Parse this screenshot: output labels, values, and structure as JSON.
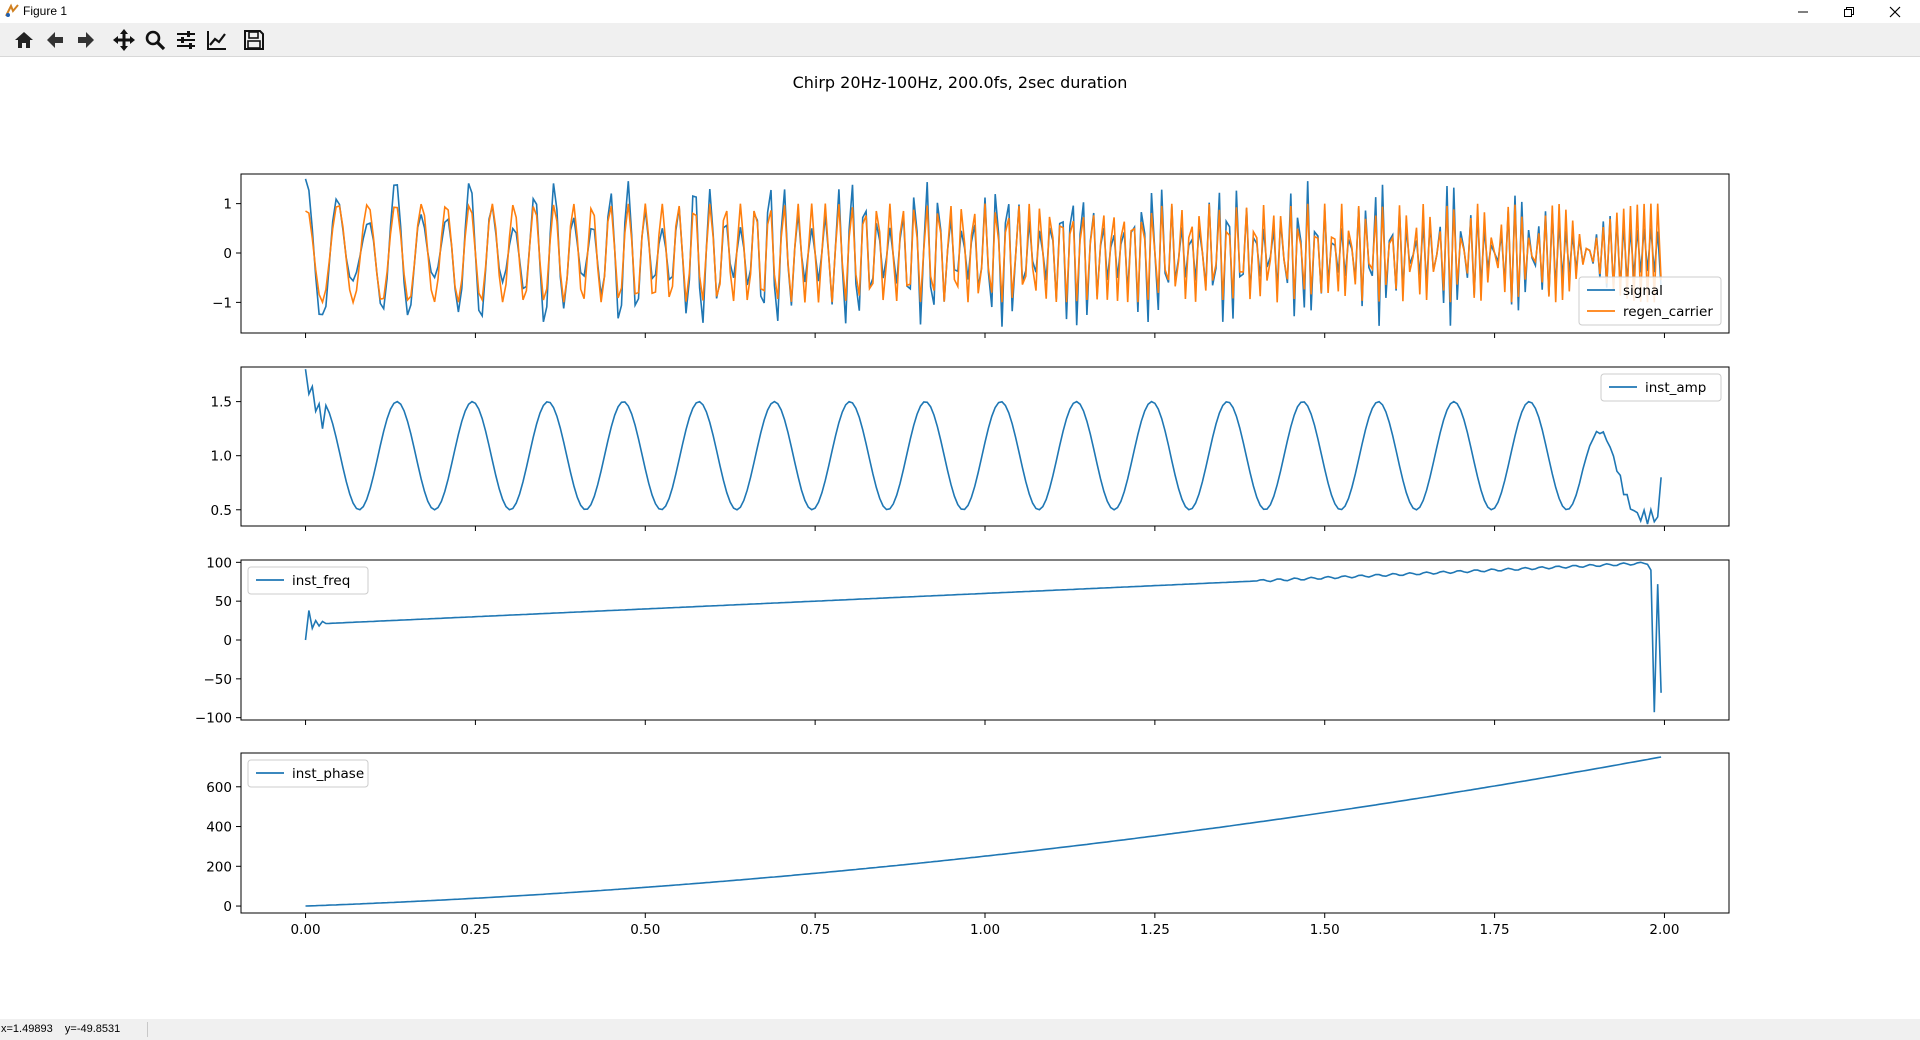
{
  "window": {
    "title": "Figure 1",
    "controls": [
      "minimize-icon",
      "restore-icon",
      "close-icon"
    ]
  },
  "toolbar": {
    "tools": [
      {
        "name": "home",
        "icon": "home-icon"
      },
      {
        "name": "back",
        "icon": "arrow-left-icon"
      },
      {
        "name": "forward",
        "icon": "arrow-right-icon"
      },
      {
        "name": "pan",
        "icon": "move-icon"
      },
      {
        "name": "zoom",
        "icon": "magnifier-icon"
      },
      {
        "name": "configure-subplots",
        "icon": "sliders-icon"
      },
      {
        "name": "edit-axes",
        "icon": "line-chart-icon"
      },
      {
        "name": "save",
        "icon": "floppy-disk-icon"
      }
    ]
  },
  "status": {
    "x_readout": "x=1.49893",
    "y_readout": "y=-49.8531"
  },
  "colors": {
    "signal": "#1f77b4",
    "regen_carrier": "#ff7f0e"
  },
  "chart_data": {
    "suptitle": "Chirp 20Hz-100Hz, 200.0fs, 2sec duration",
    "shared_x": {
      "range": [
        -0.095,
        2.095
      ],
      "ticks": [
        0.0,
        0.25,
        0.5,
        0.75,
        1.0,
        1.25,
        1.5,
        1.75,
        2.0
      ],
      "tick_labels": [
        "0.00",
        "0.25",
        "0.50",
        "0.75",
        "1.00",
        "1.25",
        "1.50",
        "1.75",
        "2.00"
      ],
      "sample_rate": 200,
      "duration": 2.0
    },
    "subplots": [
      {
        "type": "line",
        "ylim": [
          -1.62,
          1.6
        ],
        "yticks": [
          -1,
          0,
          1
        ],
        "ytick_labels": [
          "−1",
          "0",
          "1"
        ],
        "legend": "lower-right",
        "series": [
          {
            "name": "signal",
            "color": "#1f77b4",
            "formula": "amplitude-modulated chirp: (1 + 0.5 sin(2π·9t)) · cos(phase)",
            "start": 1.5,
            "end": -0.7
          },
          {
            "name": "regen_carrier",
            "color": "#ff7f0e",
            "formula": "cos(inst_phase)",
            "start": 0.85,
            "end": -0.55
          }
        ]
      },
      {
        "type": "line",
        "ylim": [
          0.35,
          1.82
        ],
        "yticks": [
          0.5,
          1.0,
          1.5
        ],
        "ytick_labels": [
          "0.5",
          "1.0",
          "1.5"
        ],
        "legend": "top-right",
        "series": [
          {
            "name": "inst_amp",
            "color": "#1f77b4",
            "center": 1.0,
            "amplitude": 0.5,
            "mod_freq_hz": 9,
            "start": 1.75,
            "tail_low": 0.42,
            "end": 0.8
          }
        ]
      },
      {
        "type": "line",
        "ylim": [
          -103,
          103
        ],
        "yticks": [
          -100,
          -50,
          0,
          50,
          100
        ],
        "ytick_labels": [
          "−100",
          "−50",
          "0",
          "50",
          "100"
        ],
        "legend": "top-left",
        "series": [
          {
            "name": "inst_freq",
            "color": "#1f77b4",
            "start": 0,
            "initial_spike": 38,
            "linear_from": 20,
            "linear_to": 100,
            "end_spike_low": -93,
            "end_spike_high": 72,
            "end": -68
          }
        ]
      },
      {
        "type": "line",
        "ylim": [
          -35,
          770
        ],
        "yticks": [
          0,
          200,
          400,
          600
        ],
        "ytick_labels": [
          "0",
          "200",
          "400",
          "600"
        ],
        "legend": "top-left",
        "series": [
          {
            "name": "inst_phase",
            "color": "#1f77b4",
            "start": 0,
            "end": 750
          }
        ]
      }
    ]
  }
}
